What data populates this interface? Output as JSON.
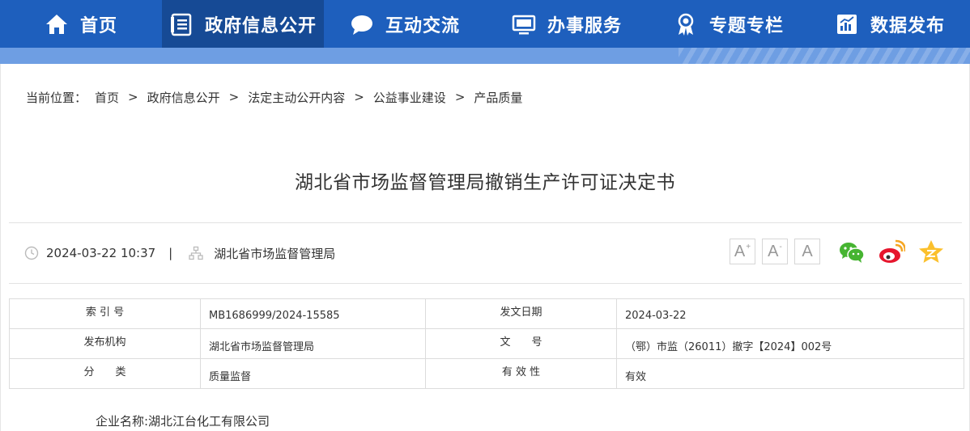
{
  "nav": {
    "items": [
      {
        "label": "首页",
        "icon": "home-icon"
      },
      {
        "label": "政府信息公开",
        "icon": "document-list-icon"
      },
      {
        "label": "互动交流",
        "icon": "chat-bubble-icon"
      },
      {
        "label": "办事服务",
        "icon": "monitor-icon"
      },
      {
        "label": "专题专栏",
        "icon": "award-ribbon-icon"
      },
      {
        "label": "数据发布",
        "icon": "bar-chart-icon"
      }
    ],
    "active_index": 1
  },
  "breadcrumb": {
    "prefix": "当前位置：",
    "separator": ">",
    "items": [
      "首页",
      "政府信息公开",
      "法定主动公开内容",
      "公益事业建设",
      "产品质量"
    ]
  },
  "article": {
    "title": "湖北省市场监督管理局撤销生产许可证决定书",
    "date": "2024-03-22 10:37",
    "divider": "|",
    "source": "湖北省市场监督管理局"
  },
  "toolbar": {
    "font_large": "A",
    "font_large_sup": "+",
    "font_small": "A",
    "font_small_sup": "-",
    "font_reset": "A"
  },
  "share": {
    "icons": [
      "wechat-icon",
      "weibo-icon",
      "qzone-icon"
    ]
  },
  "info_table": {
    "rows": [
      {
        "label1": "索 引 号",
        "value1": "MB1686999/2024-15585",
        "label2": "发文日期",
        "value2": "2024-03-22"
      },
      {
        "label1": "发布机构",
        "value1": "湖北省市场监督管理局",
        "label2": "文　　号",
        "value2": "（鄂）市监（26011）撤字【2024】002号"
      },
      {
        "label1": "分　　类",
        "value1": "质量监督",
        "label2": "有 效 性",
        "value2": "有效"
      }
    ]
  },
  "content": {
    "first_line": "企业名称:湖北江台化工有限公司"
  },
  "colors": {
    "nav_bg": "#1e5fbd",
    "nav_active": "#164a95",
    "subband": "#6e9ee3"
  }
}
